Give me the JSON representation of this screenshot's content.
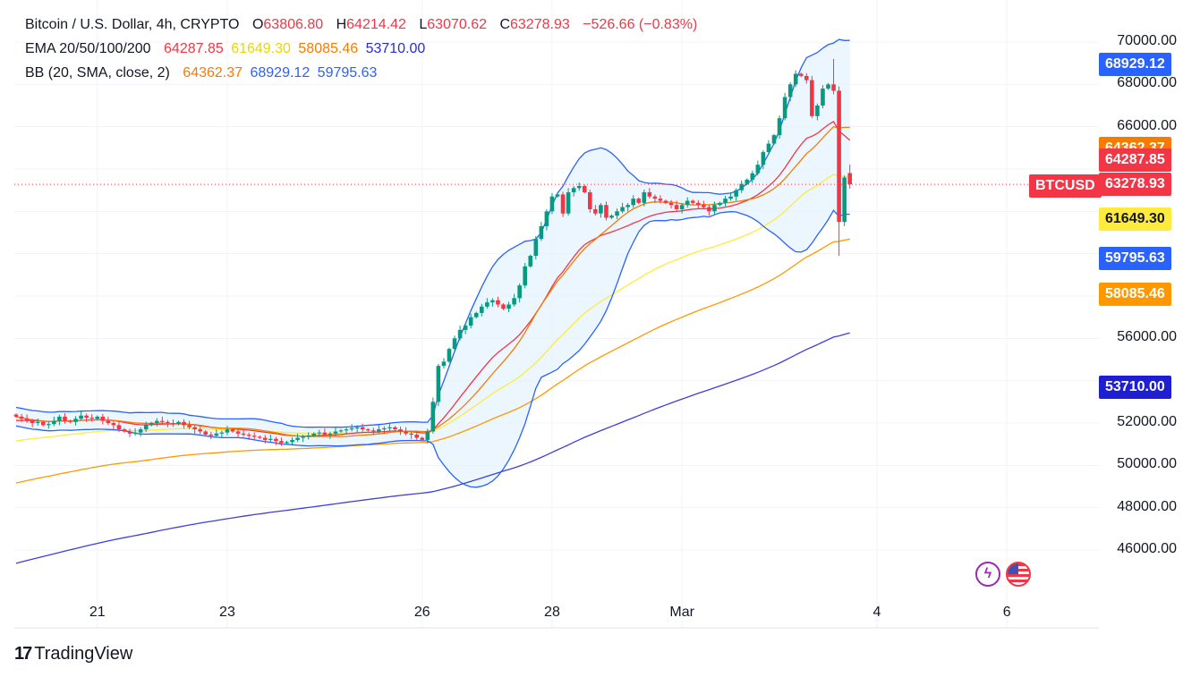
{
  "header": {
    "symbol_title": "Bitcoin / U.S. Dollar, 4h, CRYPTO",
    "ohlc": [
      {
        "label": "O",
        "value": "63806.80"
      },
      {
        "label": "H",
        "value": "64214.42"
      },
      {
        "label": "L",
        "value": "63070.62"
      },
      {
        "label": "C",
        "value": "63278.93"
      }
    ],
    "change": "−526.66 (−0.83%)",
    "ema_label": "EMA 20/50/100/200",
    "ema_values": [
      "64287.85",
      "61649.30",
      "58085.46",
      "53710.00"
    ],
    "bb_label": "BB (20, SMA, close, 2)",
    "bb_values": [
      "64362.37",
      "68929.12",
      "59795.63"
    ]
  },
  "colors": {
    "up": "#089981",
    "down": "#f23645",
    "ema20": "#f23645",
    "ema50": "#ffeb3b",
    "ema100": "#ff9800",
    "ema200": "#3f3fd6",
    "bb_basis": "#f57c00",
    "bb_band": "#2962ff",
    "bb_fill": "#e3f2fd"
  },
  "price_badges": [
    {
      "id": "bb-upper",
      "text": "68929.12",
      "color": "#2962ff",
      "text_color": "#ffffff"
    },
    {
      "id": "bb-basis",
      "text": "64362.37",
      "color": "#f57c00",
      "text_color": "#ffffff"
    },
    {
      "id": "ema20",
      "text": "64287.85",
      "color": "#f23645",
      "text_color": "#ffffff"
    },
    {
      "id": "last",
      "text": "63278.93",
      "color": "#f23645",
      "text_color": "#ffffff"
    },
    {
      "id": "ema50",
      "text": "61649.30",
      "color": "#ffeb3b",
      "text_color": "#131722"
    },
    {
      "id": "bb-lower",
      "text": "59795.63",
      "color": "#2962ff",
      "text_color": "#ffffff"
    },
    {
      "id": "ema100",
      "text": "58085.46",
      "color": "#ff9800",
      "text_color": "#ffffff"
    },
    {
      "id": "ema200",
      "text": "53710.00",
      "color": "#1e1ed2",
      "text_color": "#ffffff"
    }
  ],
  "symbol_badge": "BTCUSD",
  "footer": {
    "brand": "TradingView"
  },
  "icons": [
    "bolt-icon",
    "us-flag-icon"
  ],
  "chart_data": {
    "type": "candlestick",
    "title": "Bitcoin / U.S. Dollar, 4h, CRYPTO",
    "y_ticks": [
      46000,
      48000,
      50000,
      52000,
      54000,
      56000,
      58000,
      60000,
      62000,
      64000,
      66000,
      68000,
      70000
    ],
    "y_tick_labels": [
      "46000.00",
      "48000.00",
      "50000.00",
      "52000.00",
      "",
      "56000.00",
      "",
      "",
      "",
      "",
      "66000.00",
      "68000.00",
      "70000.00"
    ],
    "ylim": [
      44000,
      71000
    ],
    "x_tick_labels": [
      {
        "label": "21",
        "bar": 15
      },
      {
        "label": "23",
        "bar": 39
      },
      {
        "label": "26",
        "bar": 75
      },
      {
        "label": "28",
        "bar": 99
      },
      {
        "label": "Mar",
        "bar": 123
      },
      {
        "label": "4",
        "bar": 159
      },
      {
        "label": "6",
        "bar": 183
      }
    ],
    "last_price": 63278.93,
    "closes": [
      52300,
      52200,
      52100,
      52000,
      52050,
      51900,
      51950,
      52100,
      52300,
      52100,
      52050,
      52200,
      52350,
      52250,
      52200,
      52300,
      52100,
      52000,
      51900,
      51700,
      51600,
      51500,
      51550,
      51700,
      51900,
      52000,
      52100,
      52050,
      52000,
      51950,
      52050,
      51900,
      51800,
      51700,
      51600,
      51450,
      51400,
      51500,
      51550,
      51700,
      51600,
      51500,
      51450,
      51400,
      51350,
      51300,
      51200,
      51250,
      51150,
      51050,
      51100,
      51200,
      51300,
      51350,
      51400,
      51500,
      51550,
      51450,
      51500,
      51600,
      51650,
      51700,
      51750,
      51800,
      51700,
      51650,
      51600,
      51700,
      51750,
      51800,
      51700,
      51600,
      51500,
      51450,
      51300,
      51200,
      51600,
      53000,
      54700,
      54900,
      55500,
      56000,
      56400,
      56600,
      57000,
      57200,
      57500,
      57700,
      57800,
      57600,
      57400,
      57600,
      57900,
      58500,
      59400,
      59900,
      60700,
      61300,
      62000,
      62700,
      62800,
      61900,
      62900,
      63100,
      63200,
      62900,
      62100,
      61900,
      62300,
      61700,
      61800,
      62000,
      62200,
      62300,
      62600,
      62400,
      62900,
      62700,
      62600,
      62500,
      62400,
      62300,
      62100,
      62300,
      62500,
      62400,
      62300,
      62200,
      62000,
      62300,
      62400,
      62600,
      62700,
      63000,
      63300,
      63500,
      63800,
      64200,
      64800,
      65200,
      65600,
      66400,
      67400,
      68000,
      68500,
      68400,
      68200,
      66500,
      67000,
      67800,
      68000,
      67700,
      61500,
      63600,
      63279
    ]
  }
}
